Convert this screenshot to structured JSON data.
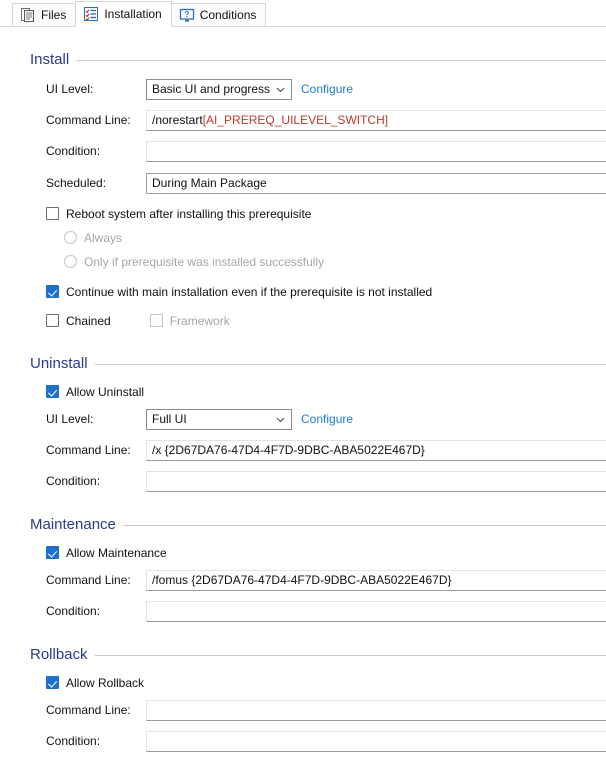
{
  "tabs": [
    {
      "label": "Files",
      "icon": "document-pages-icon",
      "active": false
    },
    {
      "label": "Installation",
      "icon": "checklist-icon",
      "active": true
    },
    {
      "label": "Conditions",
      "icon": "monitor-question-icon",
      "active": false
    }
  ],
  "colors": {
    "section_title": "#2a3a8c",
    "link": "#1d7ad4",
    "checkbox_checked": "#1d6fd0",
    "red_token": "#c0392b"
  },
  "sections": {
    "install": {
      "title": "Install",
      "ui_level": {
        "label": "UI Level:",
        "value": "Basic UI and progress",
        "configure_label": "Configure"
      },
      "command_line": {
        "label": "Command Line:",
        "value_plain": "/norestart ",
        "value_red": "[AI_PREREQ_UILEVEL_SWITCH]"
      },
      "condition": {
        "label": "Condition:",
        "value": ""
      },
      "scheduled": {
        "label": "Scheduled:",
        "value": "During Main Package"
      },
      "reboot": {
        "label": "Reboot system after installing this prerequisite",
        "checked": false
      },
      "reboot_always": {
        "label": "Always",
        "selected": false,
        "disabled": true
      },
      "reboot_only_if": {
        "label": "Only if prerequisite was installed successfully",
        "selected": false,
        "disabled": true
      },
      "continue_main": {
        "label": "Continue with main installation even if the prerequisite is not installed",
        "checked": true
      },
      "chained": {
        "label": "Chained",
        "checked": false
      },
      "framework": {
        "label": "Framework",
        "checked": false,
        "disabled": true
      }
    },
    "uninstall": {
      "title": "Uninstall",
      "allow": {
        "label": "Allow Uninstall",
        "checked": true
      },
      "ui_level": {
        "label": "UI Level:",
        "value": "Full UI",
        "configure_label": "Configure"
      },
      "command_line": {
        "label": "Command Line:",
        "value": "/x {2D67DA76-47D4-4F7D-9DBC-ABA5022E467D}"
      },
      "condition": {
        "label": "Condition:",
        "value": ""
      }
    },
    "maintenance": {
      "title": "Maintenance",
      "allow": {
        "label": "Allow Maintenance",
        "checked": true
      },
      "command_line": {
        "label": "Command Line:",
        "value": "/fomus {2D67DA76-47D4-4F7D-9DBC-ABA5022E467D}"
      },
      "condition": {
        "label": "Condition:",
        "value": ""
      }
    },
    "rollback": {
      "title": "Rollback",
      "allow": {
        "label": "Allow Rollback",
        "checked": true
      },
      "command_line": {
        "label": "Command Line:",
        "value": ""
      },
      "condition": {
        "label": "Condition:",
        "value": ""
      }
    }
  }
}
